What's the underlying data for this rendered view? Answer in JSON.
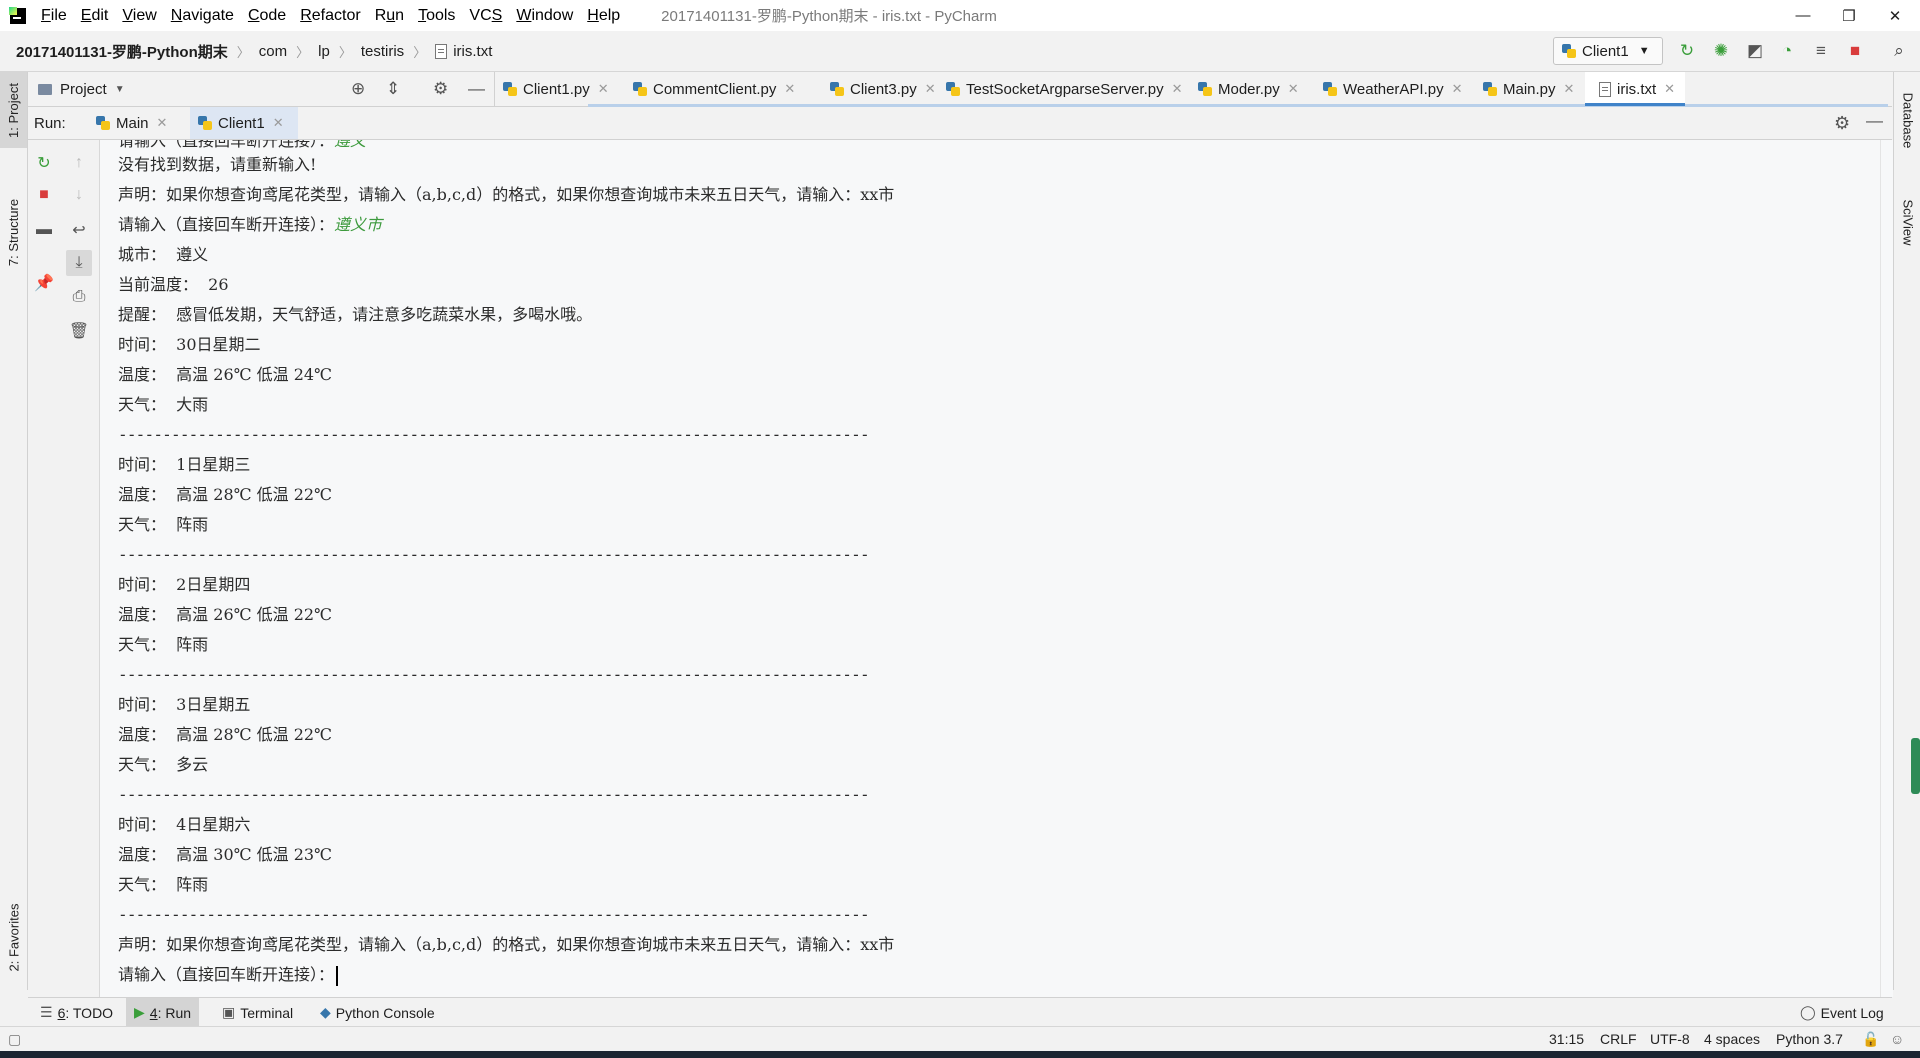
{
  "window": {
    "title": "20171401131-罗鹏-Python期末 - iris.txt - PyCharm",
    "controls": [
      "—",
      "❐",
      "✕"
    ]
  },
  "menu": {
    "items": [
      {
        "pre": "",
        "u": "F",
        "post": "ile"
      },
      {
        "pre": "",
        "u": "E",
        "post": "dit"
      },
      {
        "pre": "",
        "u": "V",
        "post": "iew"
      },
      {
        "pre": "",
        "u": "N",
        "post": "avigate"
      },
      {
        "pre": "",
        "u": "C",
        "post": "ode"
      },
      {
        "pre": "",
        "u": "R",
        "post": "efactor"
      },
      {
        "pre": "R",
        "u": "u",
        "post": "n"
      },
      {
        "pre": "",
        "u": "T",
        "post": "ools"
      },
      {
        "pre": "VC",
        "u": "S",
        "post": ""
      },
      {
        "pre": "",
        "u": "W",
        "post": "indow"
      },
      {
        "pre": "",
        "u": "H",
        "post": "elp"
      }
    ]
  },
  "breadcrumb": {
    "project": "20171401131-罗鹏-Python期末",
    "parts": [
      "com",
      "lp",
      "testiris"
    ],
    "file": "iris.txt"
  },
  "run_config": {
    "name": "Client1"
  },
  "project_panel": {
    "label": "Project"
  },
  "file_tabs": [
    {
      "label": "Client1.py",
      "icon": "python-file-icon",
      "active": false
    },
    {
      "label": "CommentClient.py",
      "icon": "python-file-icon",
      "active": false
    },
    {
      "label": "Client3.py",
      "icon": "python-file-icon",
      "active": false
    },
    {
      "label": "TestSocketArgparseServer.py",
      "icon": "python-file-icon",
      "active": false
    },
    {
      "label": "Moder.py",
      "icon": "python-file-icon",
      "active": false
    },
    {
      "label": "WeatherAPI.py",
      "icon": "python-file-icon",
      "active": false
    },
    {
      "label": "Main.py",
      "icon": "python-file-icon",
      "active": false
    },
    {
      "label": "iris.txt",
      "icon": "text-file-icon",
      "active": true
    }
  ],
  "run_panel": {
    "label": "Run:",
    "tabs": [
      {
        "label": "Main",
        "active": false
      },
      {
        "label": "Client1",
        "active": true
      }
    ]
  },
  "left_tool_tabs": {
    "project": "1: Project",
    "structure": "7: Structure",
    "favorites": "2: Favorites"
  },
  "right_tool_tabs": {
    "database": "Database",
    "sciview": "SciView"
  },
  "console": {
    "partial_top": {
      "prompt": "请输入（直接回车断开连接）：",
      "input": "遵义"
    },
    "lines": [
      {
        "text": "没有找到数据，请重新输入!"
      },
      {
        "text": "声明：如果你想查询鸢尾花类型，请输入（a,b,c,d）的格式，如果你想查询城市未来五日天气，请输入：xx市"
      },
      {
        "text": "请输入（直接回车断开连接）：",
        "input": "遵义市"
      },
      {
        "text": "城市：  遵义"
      },
      {
        "text": "当前温度：  26"
      },
      {
        "text": "提醒：  感冒低发期，天气舒适，请注意多吃蔬菜水果，多喝水哦。"
      },
      {
        "text": "时间：  30日星期二"
      },
      {
        "text": "温度：  高温 26℃ 低温 24℃"
      },
      {
        "text": "天气：  大雨"
      },
      {
        "dashes": "-------------------------------------------------------------------------------------"
      },
      {
        "text": "时间：  1日星期三"
      },
      {
        "text": "温度：  高温 28℃ 低温 22℃"
      },
      {
        "text": "天气：  阵雨"
      },
      {
        "dashes": "-------------------------------------------------------------------------------------"
      },
      {
        "text": "时间：  2日星期四"
      },
      {
        "text": "温度：  高温 26℃ 低温 22℃"
      },
      {
        "text": "天气：  阵雨"
      },
      {
        "dashes": "-------------------------------------------------------------------------------------"
      },
      {
        "text": "时间：  3日星期五"
      },
      {
        "text": "温度：  高温 28℃ 低温 22℃"
      },
      {
        "text": "天气：  多云"
      },
      {
        "dashes": "-------------------------------------------------------------------------------------"
      },
      {
        "text": "时间：  4日星期六"
      },
      {
        "text": "温度：  高温 30℃ 低温 23℃"
      },
      {
        "text": "天气：  阵雨"
      },
      {
        "dashes": "-------------------------------------------------------------------------------------"
      },
      {
        "text": "声明：如果你想查询鸢尾花类型，请输入（a,b,c,d）的格式，如果你想查询城市未来五日天气，请输入：xx市"
      },
      {
        "text": "请输入（直接回车断开连接）：",
        "caret": true
      }
    ]
  },
  "bottom_tabs": {
    "todo": {
      "num": "6",
      "label": ": TODO"
    },
    "run": {
      "num": "4",
      "label": ": Run"
    },
    "terminal": "Terminal",
    "python_console": "Python Console",
    "event_log": "Event Log"
  },
  "status": {
    "position": "31:15",
    "line_sep": "CRLF",
    "encoding": "UTF-8",
    "indent": "4 spaces",
    "interpreter": "Python 3.7"
  },
  "colors": {
    "accent": "#4083c9",
    "input_text": "#3d9a3d",
    "run_green": "#3a9e3a",
    "stop_red": "#d93c3c"
  }
}
